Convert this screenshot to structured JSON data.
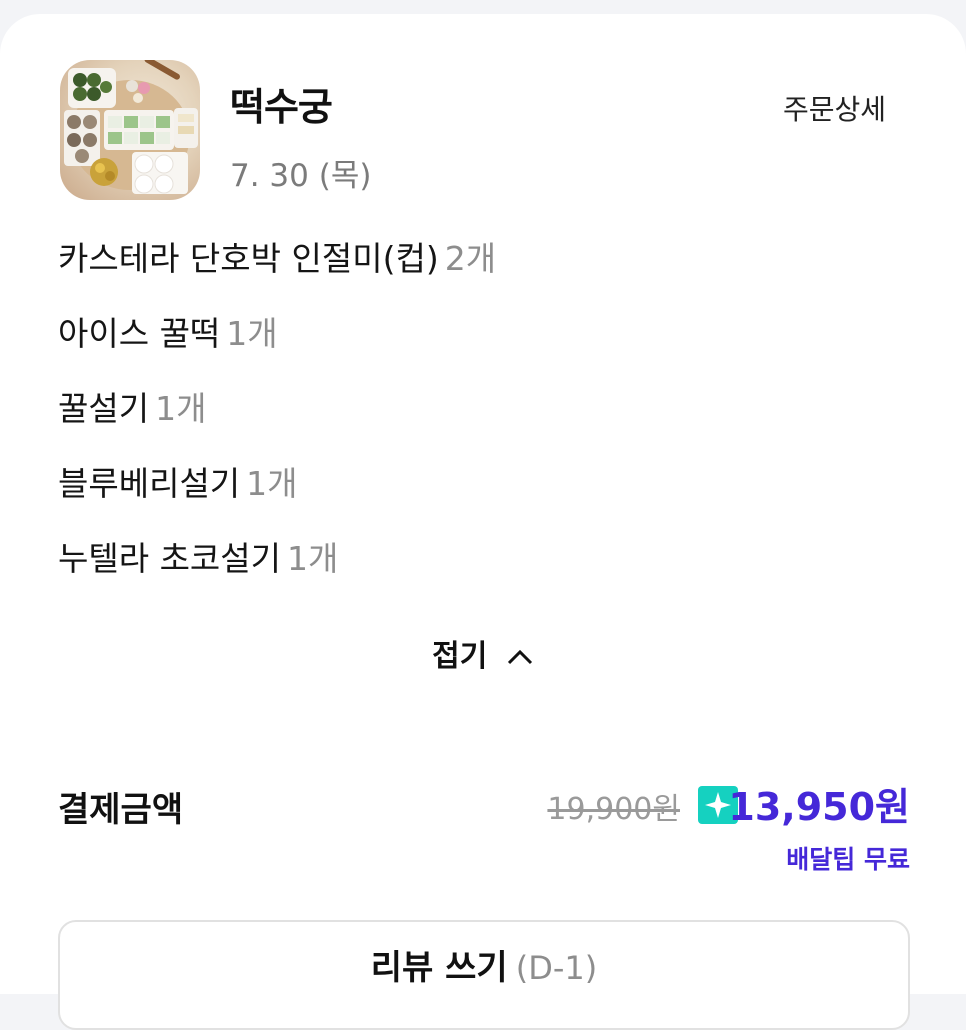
{
  "store": {
    "name": "떡수궁",
    "date": "7. 30 (목)",
    "detail_link": "주문상세"
  },
  "items": [
    {
      "name": "카스테라 단호박 인절미(컵)",
      "qty": "2개"
    },
    {
      "name": "아이스 꿀떡",
      "qty": "1개"
    },
    {
      "name": "꿀설기",
      "qty": "1개"
    },
    {
      "name": "블루베리설기",
      "qty": "1개"
    },
    {
      "name": "누텔라 초코설기",
      "qty": "1개"
    }
  ],
  "collapse_label": "접기",
  "payment": {
    "label": "결제금액",
    "original_price": "19,900원",
    "final_price": "13,950원",
    "delivery_note": "배달팁 무료"
  },
  "review": {
    "label": "리뷰 쓰기",
    "dday": "(D-1)"
  },
  "colors": {
    "accent": "#4528d8",
    "badge": "#15d1c0"
  },
  "icons": {
    "collapse": "chevron-up-icon",
    "badge": "star-badge-icon"
  }
}
